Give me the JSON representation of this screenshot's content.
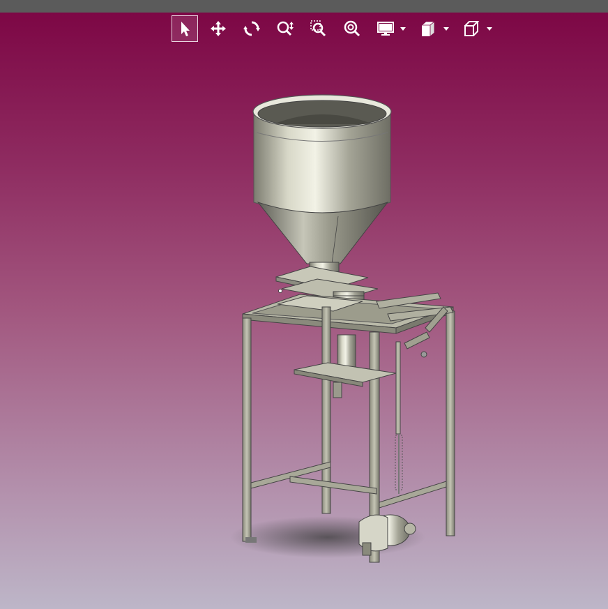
{
  "window": {
    "background_top": "#7d0745",
    "background_bottom": "#bdb6c8",
    "titlebar_color": "#5b5b5b"
  },
  "toolbar": {
    "tools": [
      {
        "icon": "select-arrow-icon",
        "active": true
      },
      {
        "icon": "pan-move-icon",
        "active": false
      },
      {
        "icon": "rotate-icon",
        "active": false
      },
      {
        "icon": "zoom-in-out-icon",
        "active": false
      },
      {
        "icon": "zoom-area-icon",
        "active": false
      },
      {
        "icon": "zoom-fit-icon",
        "active": false
      }
    ],
    "dropdowns": [
      {
        "icon": "display-monitor-icon"
      },
      {
        "icon": "render-style-icon"
      },
      {
        "icon": "view-cube-icon"
      }
    ]
  },
  "model": {
    "description_icon": "filling-machine-3d-model"
  }
}
